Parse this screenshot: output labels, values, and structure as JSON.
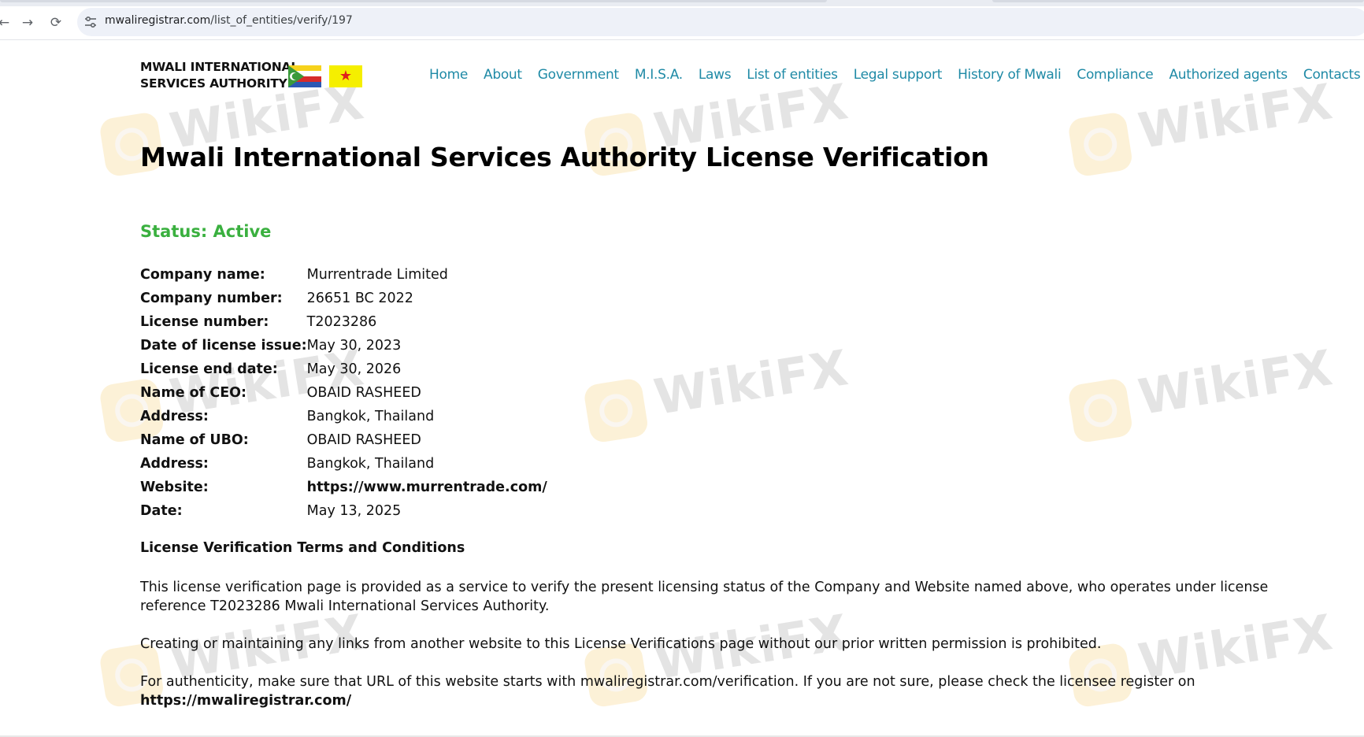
{
  "browser": {
    "back_icon": "←",
    "forward_icon": "→",
    "reload_icon": "⟳",
    "url_host": "mwaliregistrar.com",
    "url_path": "/list_of_entities/verify/197",
    "bookmark_icon": "☆"
  },
  "header": {
    "logo_line1": "MWALI INTERNATIONAL",
    "logo_line2": "SERVICES AUTHORITY",
    "flag_star": "★",
    "nav": [
      "Home",
      "About",
      "Government",
      "M.I.S.A.",
      "Laws",
      "List of entities",
      "Legal support",
      "History of Mwali",
      "Compliance",
      "Authorized agents",
      "Contacts"
    ]
  },
  "watermark": "WikiFX",
  "main": {
    "title": "Mwali International Services Authority License Verification",
    "status": "Status: Active",
    "details": [
      {
        "label": "Company name:",
        "value": "Murrentrade Limited"
      },
      {
        "label": "Company number:",
        "value": "26651 BC 2022"
      },
      {
        "label": "License number:",
        "value": "T2023286"
      },
      {
        "label": "Date of license issue:",
        "value": "May 30, 2023"
      },
      {
        "label": "License end date:",
        "value": "May 30, 2026"
      },
      {
        "label": "Name of CEO:",
        "value": "OBAID RASHEED"
      },
      {
        "label": "Address:",
        "value": "Bangkok, Thailand"
      },
      {
        "label": "Name of UBO:",
        "value": "OBAID RASHEED"
      },
      {
        "label": "Address:",
        "value": "Bangkok, Thailand"
      },
      {
        "label": "Website:",
        "value": "https://www.murrentrade.com/"
      },
      {
        "label": "Date:",
        "value": "May 13, 2025"
      }
    ],
    "terms_title": "License Verification Terms and Conditions",
    "paragraph1": "This license verification page is provided as a service to verify the present licensing status of the Company and Website named above, who operates under license reference T2023286 Mwali International Services Authority.",
    "paragraph2": "Creating or maintaining any links from another website to this License Verifications page without our prior written permission is prohibited.",
    "paragraph3": "For authenticity, make sure that URL of this website starts with mwaliregistrar.com/verification. If you are not sure, please check the licensee register on",
    "register_link": "https://mwaliregistrar.com/"
  },
  "colors": {
    "nav_link": "#1f8aa6",
    "status_active": "#3ab03f",
    "flag_yellow": "#f5ef00",
    "flag_star": "#e0201b"
  }
}
